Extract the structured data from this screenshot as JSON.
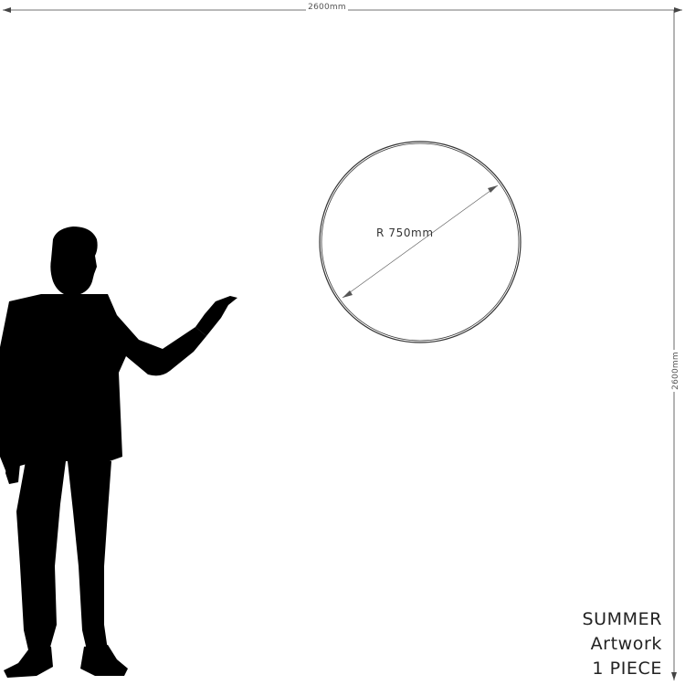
{
  "dimensions": {
    "width_label": "2600mm",
    "height_label": "2600mm"
  },
  "artwork": {
    "radius_label": "R 750mm"
  },
  "caption": {
    "line1": "SUMMER",
    "line2": "Artwork",
    "line3": "1 PIECE"
  },
  "colors": {
    "line": "#333333",
    "silhouette": "#000000",
    "background": "#ffffff"
  },
  "icons": {
    "figure": "person-silhouette-icon",
    "arrows": "arrow-head-icon"
  }
}
